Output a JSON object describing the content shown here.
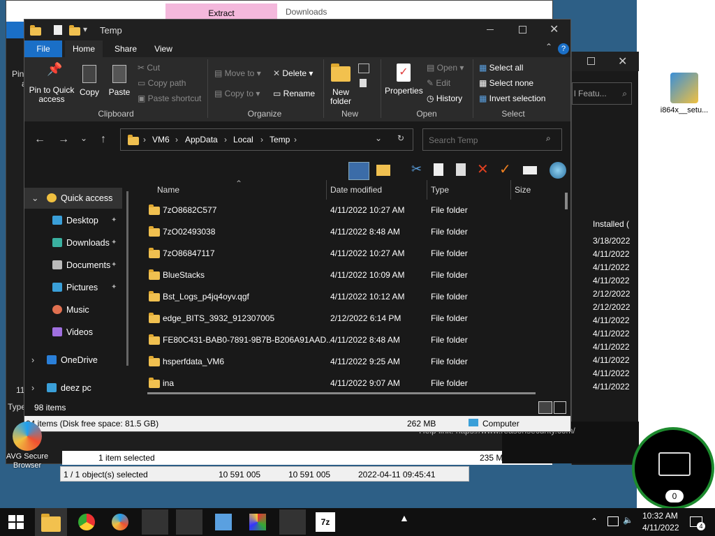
{
  "back_window": {
    "tab_extract": "Extract",
    "tab_downloads": "Downloads",
    "status_selected": "1 item selected",
    "status_size": "235 MB",
    "status_location": "Computer"
  },
  "winrar_window": {
    "status_selected": "1 / 1 object(s) selected",
    "size1": "10 591 005",
    "size2": "10 591 005",
    "datetime": "2022-04-11 09:45:41"
  },
  "right_window": {
    "search_placeholder": "l Featu...",
    "column_installed": "Installed (",
    "dates": [
      "3/18/2022",
      "4/11/2022",
      "4/11/2022",
      "4/11/2022",
      "2/12/2022",
      "2/12/2022",
      "4/11/2022",
      "4/11/2022",
      "4/11/2022",
      "4/11/2022",
      "4/11/2022",
      "4/11/2022"
    ],
    "help_link": "Help link:    https://www.reasonsecurity.com/"
  },
  "explorer": {
    "title": "Temp",
    "tabs": [
      "File",
      "Home",
      "Share",
      "View"
    ],
    "ribbon": {
      "pin_label": "Pin to Quick access",
      "copy": "Copy",
      "paste": "Paste",
      "cut": "Cut",
      "copy_path": "Copy path",
      "paste_shortcut": "Paste shortcut",
      "move_to": "Move to",
      "copy_to": "Copy to",
      "delete": "Delete",
      "rename": "Rename",
      "new_folder": "New folder",
      "properties": "Properties",
      "open": "Open",
      "edit": "Edit",
      "history": "History",
      "select_all": "Select all",
      "select_none": "Select none",
      "invert_selection": "Invert selection",
      "group_clipboard": "Clipboard",
      "group_organize": "Organize",
      "group_new": "New",
      "group_open": "Open",
      "group_select": "Select"
    },
    "breadcrumb": [
      "VM6",
      "AppData",
      "Local",
      "Temp"
    ],
    "search_placeholder": "Search Temp",
    "nav": [
      {
        "label": "Quick access",
        "icon": "star-icon"
      },
      {
        "label": "Desktop",
        "icon": "desktop-icon"
      },
      {
        "label": "Downloads",
        "icon": "download-icon"
      },
      {
        "label": "Documents",
        "icon": "document-icon"
      },
      {
        "label": "Pictures",
        "icon": "picture-icon"
      },
      {
        "label": "Music",
        "icon": "music-icon"
      },
      {
        "label": "Videos",
        "icon": "video-icon"
      },
      {
        "label": "OneDrive",
        "icon": "cloud-icon"
      },
      {
        "label": "deez pc",
        "icon": "computer-icon"
      }
    ],
    "columns": {
      "name": "Name",
      "date": "Date modified",
      "type": "Type",
      "size": "Size"
    },
    "files": [
      {
        "name": "7zO8682C577",
        "date": "4/11/2022 10:27 AM",
        "type": "File folder"
      },
      {
        "name": "7zO02493038",
        "date": "4/11/2022 8:48 AM",
        "type": "File folder"
      },
      {
        "name": "7zO86847117",
        "date": "4/11/2022 10:27 AM",
        "type": "File folder"
      },
      {
        "name": "BlueStacks",
        "date": "4/11/2022 10:09 AM",
        "type": "File folder"
      },
      {
        "name": "Bst_Logs_p4jq4oyv.qgf",
        "date": "4/11/2022 10:12 AM",
        "type": "File folder"
      },
      {
        "name": "edge_BITS_3932_912307005",
        "date": "2/12/2022 6:14 PM",
        "type": "File folder"
      },
      {
        "name": "FE80C431-BAB0-7891-9B7B-B206A91AAD...",
        "date": "4/11/2022 8:48 AM",
        "type": "File folder"
      },
      {
        "name": "hsperfdata_VM6",
        "date": "4/11/2022 9:25 AM",
        "type": "File folder"
      },
      {
        "name": "ina",
        "date": "4/11/2022 9:07 AM",
        "type": "File folder"
      }
    ],
    "item_count": "98 items",
    "status_disk": "94 items (Disk free space: 81.5 GB)",
    "status_size": "262 MB",
    "status_location": "Computer"
  },
  "desktop": {
    "avg_label": "AVG Secure Browser",
    "setup_label": "i864x__setu...",
    "left_edge": [
      "Pin",
      "a",
      "11",
      "Type"
    ]
  },
  "widget": {
    "count": "0"
  },
  "taskbar": {
    "time": "10:32 AM",
    "date": "4/11/2022",
    "notification_count": "4"
  }
}
